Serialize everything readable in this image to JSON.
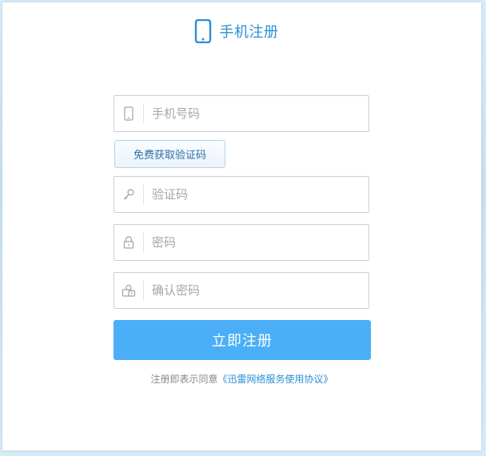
{
  "header": {
    "title": "手机注册",
    "icon": "mobile-phone-icon"
  },
  "form": {
    "phone": {
      "placeholder": "手机号码",
      "value": "",
      "icon": "mobile-phone-icon"
    },
    "get_code_label": "免费获取验证码",
    "code": {
      "placeholder": "验证码",
      "value": "",
      "icon": "key-icon"
    },
    "password": {
      "placeholder": "密码",
      "value": "",
      "icon": "lock-icon"
    },
    "confirm_password": {
      "placeholder": "确认密码",
      "value": "",
      "icon": "lock-confirm-icon"
    },
    "submit_label": "立即注册"
  },
  "agreement": {
    "prefix": "注册即表示同意",
    "link_text": "《迅雷网络服务使用协议》"
  },
  "colors": {
    "accent": "#2a8fd6",
    "submit_bg": "#4aaff7",
    "border": "#c9cfd6",
    "background": "#d9ebf7"
  }
}
